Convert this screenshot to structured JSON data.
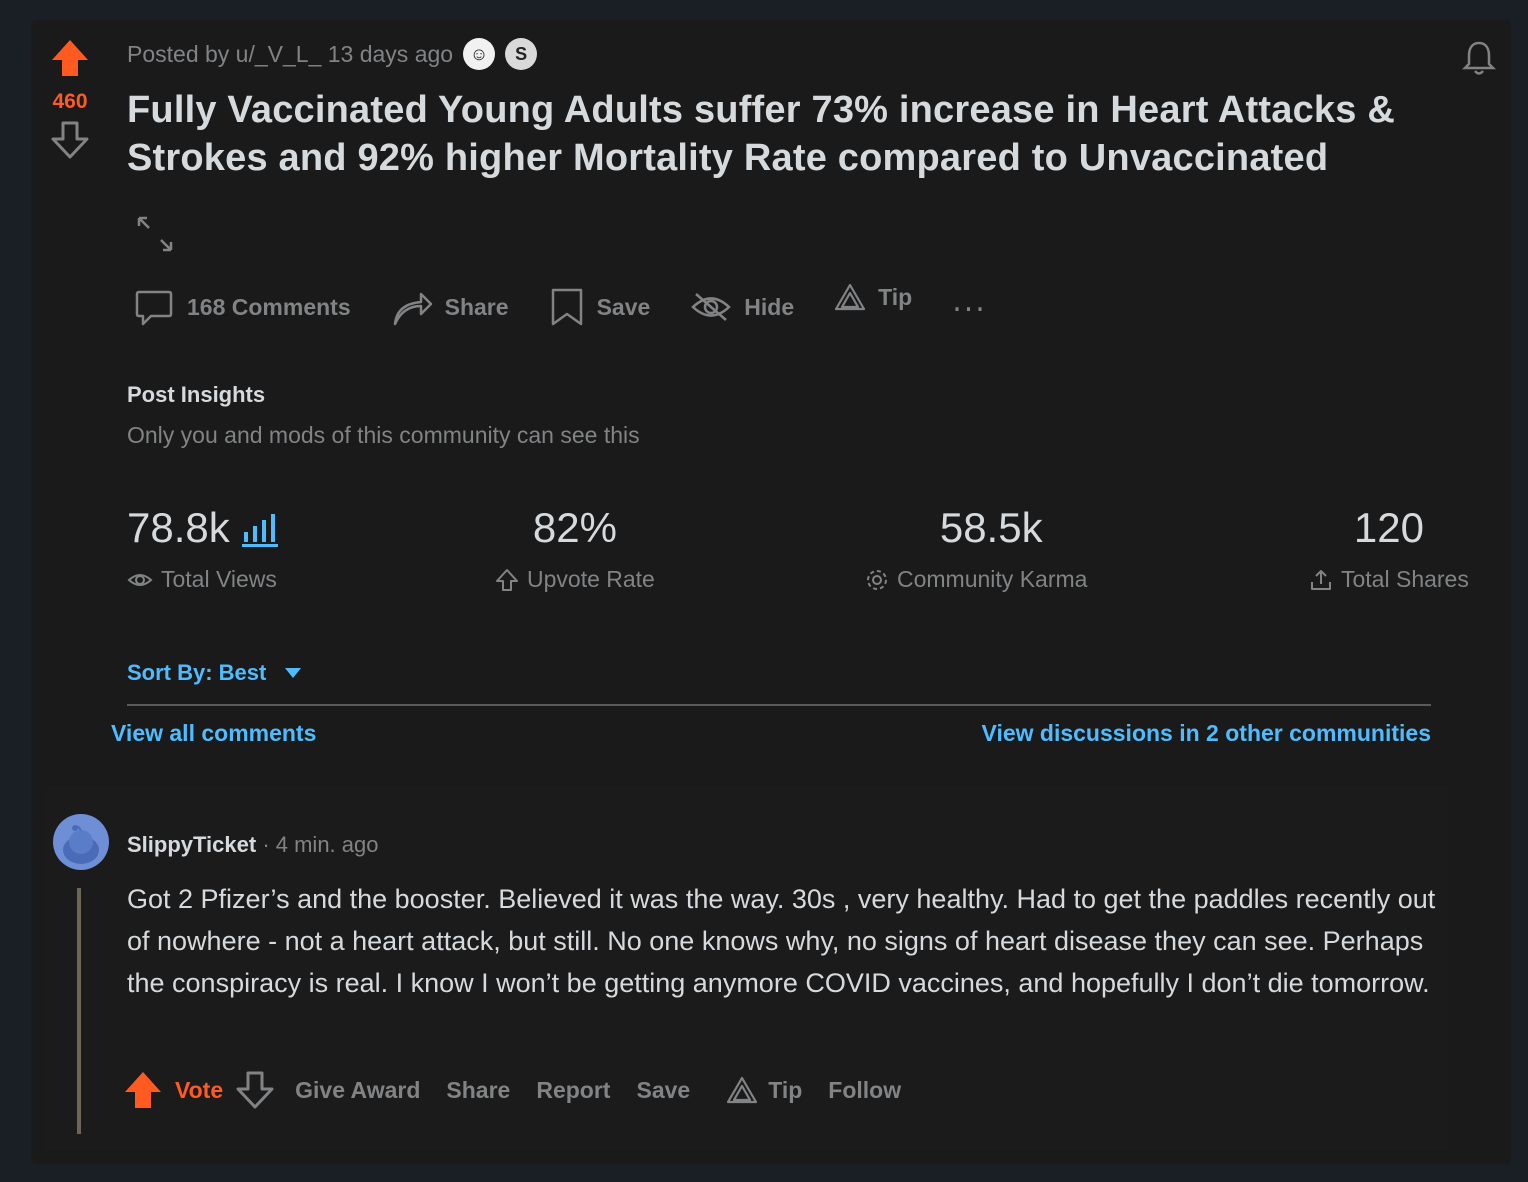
{
  "post": {
    "score": "460",
    "meta": "Posted by u/_V_L_ 13 days ago",
    "title": "Fully Vaccinated Young Adults suffer 73% increase in Heart Attacks & Strokes and 92% higher Mortality Rate compared to Unvaccinated",
    "accent_color": "#ff5a1f",
    "link_color": "#4fbcff"
  },
  "actions": {
    "comments": "168 Comments",
    "share": "Share",
    "save": "Save",
    "hide": "Hide",
    "tip": "Tip",
    "more": "..."
  },
  "insights": {
    "title": "Post Insights",
    "subtitle": "Only you and mods of this community can see this",
    "stats": [
      {
        "value": "78.8k",
        "label": "Total Views",
        "icon": "eye-icon"
      },
      {
        "value": "82%",
        "label": "Upvote Rate",
        "icon": "upvote-outline-icon"
      },
      {
        "value": "58.5k",
        "label": "Community Karma",
        "icon": "karma-icon"
      },
      {
        "value": "120",
        "label": "Total Shares",
        "icon": "share-up-icon"
      }
    ]
  },
  "sort": {
    "label": "Sort By: Best"
  },
  "links": {
    "view_all": "View all comments",
    "view_discussions": "View discussions in 2 other communities"
  },
  "comment": {
    "author": "SlippyTicket",
    "time": " · 4 min. ago",
    "body": "Got 2 Pfizer’s and the booster. Believed it was the way. 30s , very healthy. Had to get the paddles recently out of nowhere - not a heart attack, but still. No one knows why, no signs of heart disease they can see. Perhaps the conspiracy is real. I know I won’t be getting anymore COVID vaccines, and hopefully I don’t die tomorrow.",
    "actions": {
      "vote": "Vote",
      "give_award": "Give Award",
      "share": "Share",
      "report": "Report",
      "save": "Save",
      "tip": "Tip",
      "follow": "Follow"
    }
  }
}
